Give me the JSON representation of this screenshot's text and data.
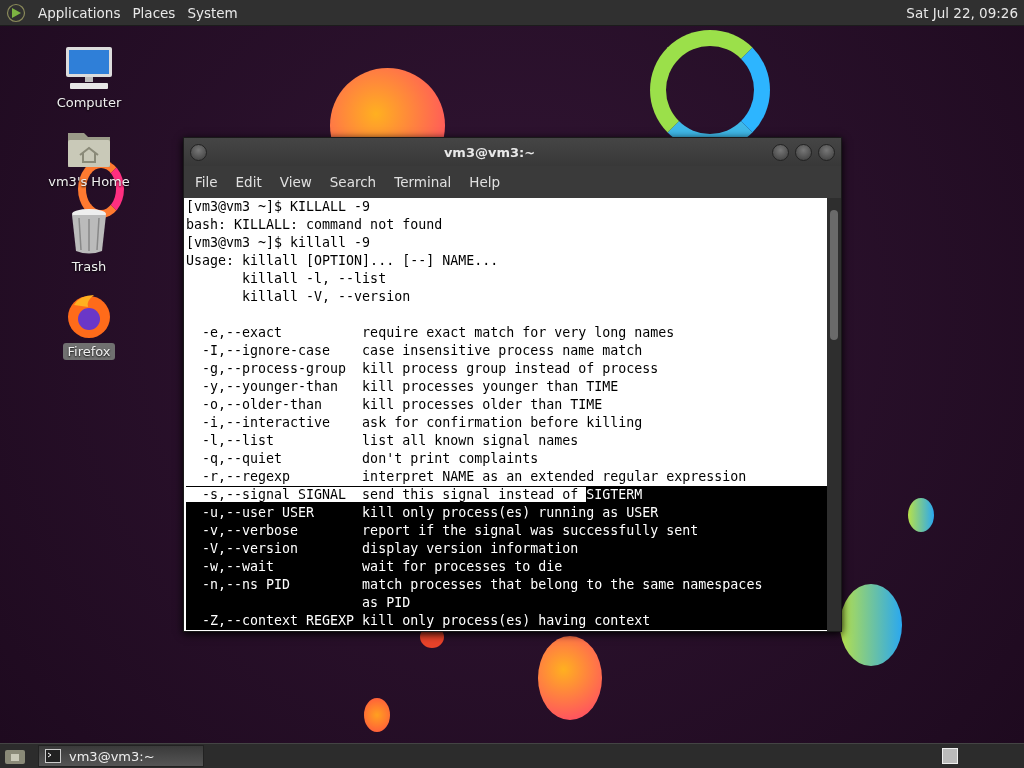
{
  "top_panel": {
    "menus": [
      "Applications",
      "Places",
      "System"
    ],
    "clock": "Sat Jul 22, 09:26"
  },
  "desktop_icons": [
    {
      "kind": "computer",
      "label": "Computer",
      "selected": false
    },
    {
      "kind": "home",
      "label": "vm3's Home",
      "selected": false
    },
    {
      "kind": "trash",
      "label": "Trash",
      "selected": false
    },
    {
      "kind": "browser",
      "label": "Firefox",
      "selected": true
    }
  ],
  "window": {
    "title": "vm3@vm3:~",
    "menu": [
      "File",
      "Edit",
      "View",
      "Search",
      "Terminal",
      "Help"
    ],
    "lines": [
      {
        "segments": [
          {
            "text": "[vm3@vm3 ~]$ KILLALL -9",
            "inverted": false
          }
        ]
      },
      {
        "segments": [
          {
            "text": "bash: KILLALL: command not found",
            "inverted": false
          }
        ]
      },
      {
        "segments": [
          {
            "text": "[vm3@vm3 ~]$ killall -9",
            "inverted": false
          }
        ]
      },
      {
        "segments": [
          {
            "text": "Usage: killall [OPTION]... [--] NAME...",
            "inverted": false
          }
        ]
      },
      {
        "segments": [
          {
            "text": "       killall -l, --list",
            "inverted": false
          }
        ]
      },
      {
        "segments": [
          {
            "text": "       killall -V, --version",
            "inverted": false
          }
        ]
      },
      {
        "gap_before": true,
        "segments": [
          {
            "text": "  -e,--exact          require exact match for very long names",
            "inverted": false
          }
        ]
      },
      {
        "segments": [
          {
            "text": "  -I,--ignore-case    case insensitive process name match",
            "inverted": false
          }
        ]
      },
      {
        "segments": [
          {
            "text": "  -g,--process-group  kill process group instead of process",
            "inverted": false
          }
        ]
      },
      {
        "segments": [
          {
            "text": "  -y,--younger-than   kill processes younger than TIME",
            "inverted": false
          }
        ]
      },
      {
        "segments": [
          {
            "text": "  -o,--older-than     kill processes older than TIME",
            "inverted": false
          }
        ]
      },
      {
        "segments": [
          {
            "text": "  -i,--interactive    ask for confirmation before killing",
            "inverted": false
          }
        ]
      },
      {
        "segments": [
          {
            "text": "  -l,--list           list all known signal names",
            "inverted": false
          }
        ]
      },
      {
        "segments": [
          {
            "text": "  -q,--quiet          don't print complaints",
            "inverted": false
          }
        ]
      },
      {
        "segments": [
          {
            "text": "  -r,--regexp         interpret NAME as an extended regular expression",
            "inverted": false
          }
        ]
      },
      {
        "segments": [
          {
            "text": "  -s,--signal SIGNAL  send this signal instead of ",
            "inverted": false
          },
          {
            "text": "SIGTERM",
            "inverted": true
          }
        ]
      },
      {
        "segments": [
          {
            "text": "  -u,--user USER      kill only process(es) running as USER",
            "inverted": true
          }
        ]
      },
      {
        "segments": [
          {
            "text": "  -v,--verbose        report if the signal was successfully sent",
            "inverted": true
          }
        ]
      },
      {
        "segments": [
          {
            "text": "  -V,--version        display version information",
            "inverted": true
          }
        ]
      },
      {
        "segments": [
          {
            "text": "  -w,--wait           wait for processes to die",
            "inverted": true
          }
        ]
      },
      {
        "segments": [
          {
            "text": "  -n,--ns PID         match processes that belong to the same namespaces",
            "inverted": true
          }
        ]
      },
      {
        "segments": [
          {
            "text": "                      as PID",
            "inverted": true
          }
        ]
      },
      {
        "segments": [
          {
            "text": "  -Z,--context REGEXP kill only process(es) having context",
            "inverted": true
          }
        ]
      }
    ]
  },
  "taskbar": {
    "tasks": [
      {
        "label": "vm3@vm3:~",
        "selected": false
      }
    ]
  }
}
